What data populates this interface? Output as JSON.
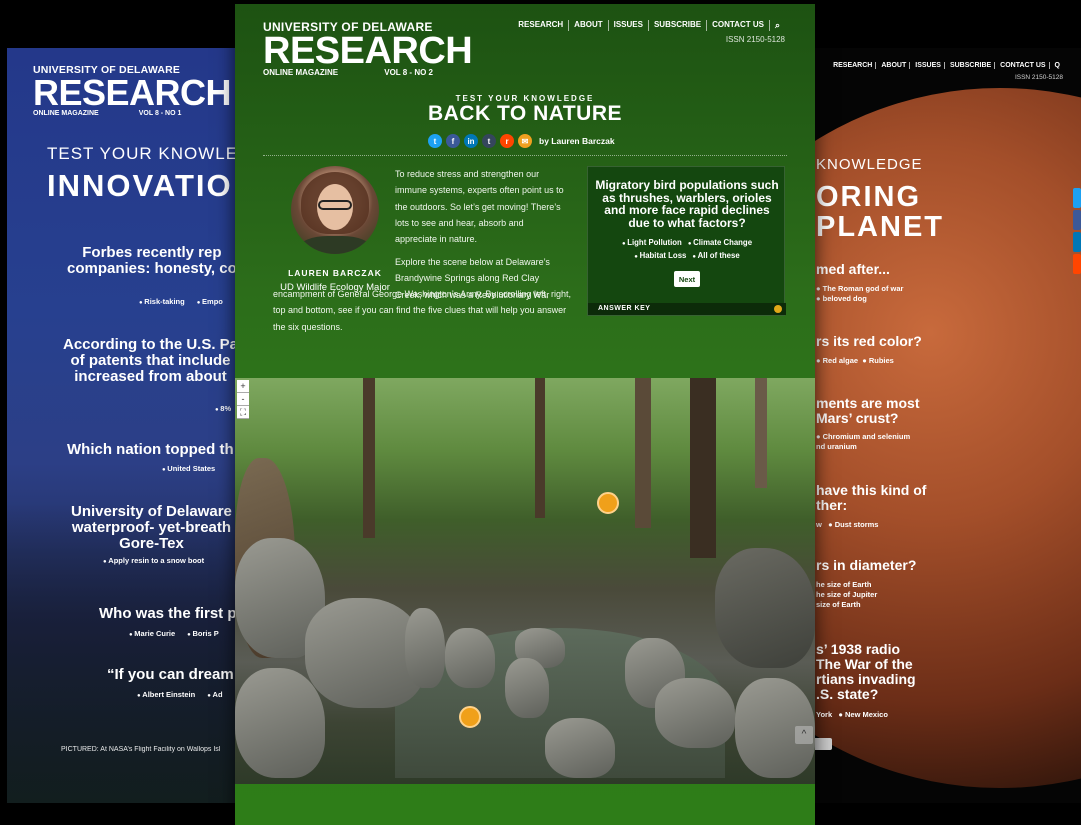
{
  "left_page": {
    "brand": {
      "university": "UNIVERSITY OF DELAWARE",
      "name": "RESEARCH",
      "sub": "ONLINE MAGAZINE",
      "vol": "VOL 8 - NO 1"
    },
    "kicker": "TEST YOUR KNOWLEDGE",
    "headline": "INNOVATIO",
    "questions": [
      {
        "text": "Forbes recently rep\ncompanies: honesty, co",
        "options": [
          "Risk-taking",
          "Empo"
        ]
      },
      {
        "text": "According to the U.S. Pa\nof patents that include\nincreased from about",
        "options": [
          "8%"
        ]
      },
      {
        "text": "Which nation topped th",
        "options": [
          "United States"
        ]
      },
      {
        "text": "University of Delaware\nwaterproof- yet-breath\nGore-Tex",
        "options": [
          "Apply resin to a snow boot"
        ]
      },
      {
        "text": "Who was the first p",
        "options": [
          "Marie Curie",
          "Boris P"
        ]
      },
      {
        "text": "“If you can dream",
        "options": [
          "Albert Einstein",
          "Ad"
        ]
      }
    ],
    "caption": "PICTURED: At NASA’s Flight Facility on Wallops Isl"
  },
  "right_page": {
    "nav": [
      "RESEARCH",
      "ABOUT",
      "ISSUES",
      "SUBSCRIBE",
      "CONTACT US",
      "Q"
    ],
    "issn": "ISSN 2150-5128",
    "kicker": "KNOWLEDGE",
    "headline": "ORING\nPLANET",
    "questions": [
      {
        "text": "med after...",
        "options": "● The Roman god of war\n● beloved dog"
      },
      {
        "text": "rs its red color?",
        "options": "● Red algae  ● Rubies"
      },
      {
        "text": "ments are most\nMars’ crust?",
        "options": "● Chromium and selenium\nnd uranium"
      },
      {
        "text": "have this kind of\nther:",
        "options": "w   ● Dust storms"
      },
      {
        "text": "rs in diameter?",
        "options": "he size of Earth\nhe size of Jupiter\nsize of Earth"
      },
      {
        "text": "s’ 1938 radio\nThe War of the\nrtians invading\n.S. state?",
        "options": "York   ● New Mexico"
      }
    ]
  },
  "center_page": {
    "brand": {
      "university": "UNIVERSITY OF DELAWARE",
      "name": "RESEARCH",
      "sub": "ONLINE MAGAZINE",
      "vol": "VOL 8 - NO 2"
    },
    "nav": [
      "RESEARCH",
      "ABOUT",
      "ISSUES",
      "SUBSCRIBE",
      "CONTACT US"
    ],
    "search_icon": "⌕",
    "issn": "ISSN 2150-5128",
    "kicker": "TEST YOUR KNOWLEDGE",
    "title": "BACK TO NATURE",
    "share_icons": [
      {
        "name": "twitter-icon",
        "glyph": "t",
        "color": "#1da1f2"
      },
      {
        "name": "facebook-icon",
        "glyph": "f",
        "color": "#3b5998"
      },
      {
        "name": "linkedin-icon",
        "glyph": "in",
        "color": "#0077b5"
      },
      {
        "name": "tumblr-icon",
        "glyph": "t",
        "color": "#35465c"
      },
      {
        "name": "reddit-icon",
        "glyph": "r",
        "color": "#ff4500"
      },
      {
        "name": "email-icon",
        "glyph": "✉",
        "color": "#f0a020"
      }
    ],
    "byline": "by Lauren Barczak",
    "author_name": "LAUREN BARCZAK",
    "author_role": "UD Wildlife Ecology Major",
    "para1": "To reduce stress and strengthen our immune systems, experts often point us to the outdoors. So let’s get moving! There’s lots to see and hear, absorb and appreciate in nature.",
    "para2": "Explore the scene below at Delaware’s Brandywine Springs along Red Clay Creek, which was a Revolutionary War",
    "para2b": "encampment of General George Washington’s Army. By scrolling left, right, top and bottom, see if you can find the five clues that will help you answer the six questions.",
    "quiz": {
      "question": "Migratory bird populations such as thrushes, warblers, orioles and more face rapid declines due to what factors?",
      "options_row1": [
        "Light Pollution",
        "Climate Change"
      ],
      "options_row2": [
        "Habitat Loss",
        "All of these"
      ],
      "next_label": "Next",
      "answer_key": "ANSWER KEY"
    },
    "zoom_in": "+",
    "zoom_out": "-",
    "fullscreen": "⛶",
    "scroll_top": "^"
  },
  "colors": {
    "green_bg": "#2c6d1a",
    "quiz_bg": "#14470f",
    "hotspot": "#f0a01a",
    "left_bg": "#27408f"
  }
}
